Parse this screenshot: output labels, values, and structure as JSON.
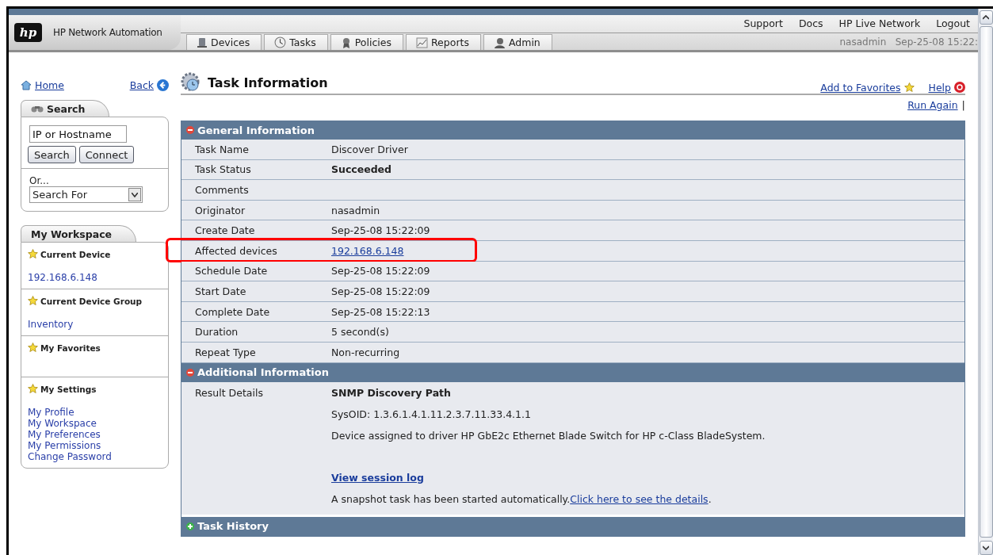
{
  "header": {
    "product": "HP Network Automation",
    "logo": "hp",
    "top_links": [
      "Support",
      "Docs",
      "HP Live Network",
      "Logout"
    ],
    "nav_tabs": [
      {
        "label": "Devices",
        "selected": false
      },
      {
        "label": "Tasks",
        "selected": false
      },
      {
        "label": "Policies",
        "selected": false
      },
      {
        "label": "Reports",
        "selected": false
      },
      {
        "label": "Admin",
        "selected": false
      }
    ],
    "user": "nasadmin",
    "datetime": "Sep-25-08 15:22:"
  },
  "sidebar": {
    "home": "Home",
    "back": "Back",
    "search": {
      "title": "Search",
      "field_value": "IP or Hostname",
      "buttons": [
        "Search",
        "Connect"
      ],
      "or_label": "Or...",
      "select_value": "Search For"
    },
    "workspace": {
      "title": "My Workspace",
      "sections": [
        {
          "title": "Current Device",
          "links": [
            "192.168.6.148"
          ]
        },
        {
          "title": "Current Device Group",
          "links": [
            "Inventory"
          ]
        },
        {
          "title": "My Favorites"
        },
        {
          "title": "My Settings",
          "links": [
            "My Profile",
            "My Workspace",
            "My Preferences",
            "My Permissions",
            "Change Password"
          ]
        }
      ]
    }
  },
  "main": {
    "title": "Task Information",
    "add_favorites": "Add to Favorites",
    "help": "Help",
    "run_again": "Run Again",
    "separator": "|",
    "general": {
      "title": "General Information",
      "expanded": true,
      "rows": [
        {
          "label": "Task Name",
          "value": "Discover Driver",
          "kind": "text",
          "highlighted": false
        },
        {
          "label": "Task Status",
          "value": "Succeeded",
          "kind": "bold",
          "highlighted": false
        },
        {
          "label": "Comments",
          "highlighted": false
        },
        {
          "label": "Originator",
          "value": "nasadmin",
          "kind": "text",
          "highlighted": false
        },
        {
          "label": "Create Date",
          "value": "Sep-25-08 15:22:09",
          "kind": "text",
          "highlighted": false
        },
        {
          "label": "Affected devices",
          "value": "192.168.6.148",
          "kind": "link",
          "highlighted": true
        },
        {
          "label": "Schedule Date",
          "value": "Sep-25-08 15:22:09",
          "kind": "text",
          "highlighted": false
        },
        {
          "label": "Start Date",
          "value": "Sep-25-08 15:22:09",
          "kind": "text",
          "highlighted": false
        },
        {
          "label": "Complete Date",
          "value": "Sep-25-08 15:22:13",
          "kind": "text",
          "highlighted": false
        },
        {
          "label": "Duration",
          "value": "5 second(s)",
          "kind": "text",
          "highlighted": false
        },
        {
          "label": "Repeat Type",
          "value": "Non-recurring",
          "kind": "text",
          "highlighted": false
        }
      ]
    },
    "additional": {
      "title": "Additional Information",
      "expanded": true,
      "label": "Result Details",
      "lines": [
        {
          "kind": "heading",
          "text": "SNMP Discovery Path"
        },
        {
          "kind": "text",
          "text": "SysOID: 1.3.6.1.4.1.11.2.3.7.11.33.4.1.1"
        },
        {
          "kind": "text",
          "text": "Device assigned to driver HP GbE2c Ethernet Blade Switch for HP c-Class BladeSystem."
        },
        {
          "kind": "gap"
        },
        {
          "kind": "bold_link",
          "text": "View session log"
        },
        {
          "kind": "text_link",
          "text": "A snapshot task has been started automatically.",
          "link": "Click here to see the details",
          "after": "."
        }
      ]
    },
    "history": {
      "title": "Task History",
      "expanded": false
    }
  }
}
